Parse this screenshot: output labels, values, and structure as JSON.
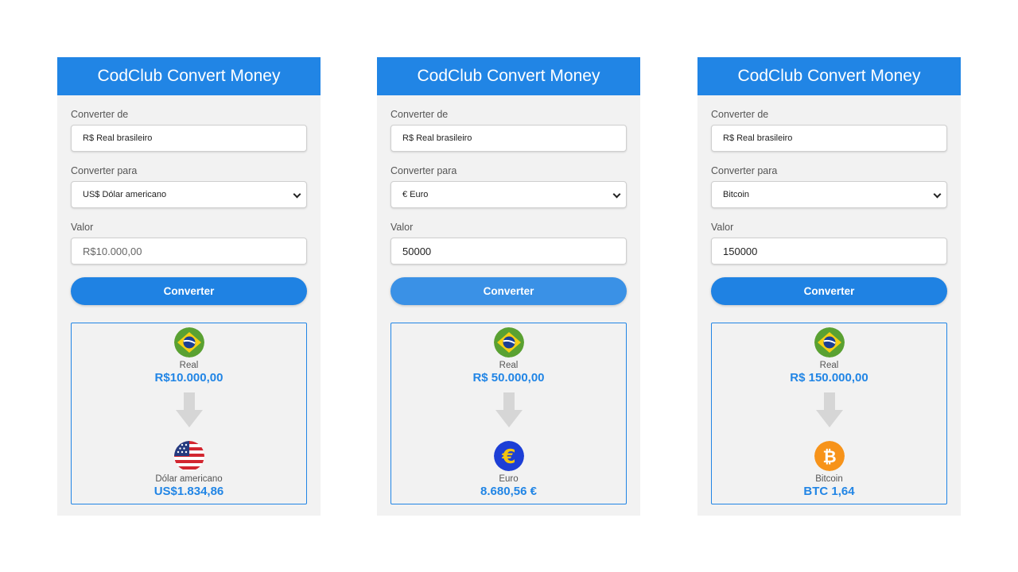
{
  "panels": [
    {
      "title": "CodClub Convert Money",
      "from_label": "Converter de",
      "from_value": "R$ Real brasileiro",
      "to_label": "Converter para",
      "to_value": "US$ Dólar americano",
      "amount_label": "Valor",
      "amount_value": "R$10.000,00",
      "amount_is_placeholder": true,
      "button_label": "Converter",
      "source_name": "Real",
      "source_amount": "R$10.000,00",
      "target_name": "Dólar americano",
      "target_amount": "US$1.834,86",
      "target_icon": "us-flag-icon"
    },
    {
      "title": "CodClub Convert Money",
      "from_label": "Converter de",
      "from_value": "R$ Real brasileiro",
      "to_label": "Converter para",
      "to_value": "€ Euro",
      "amount_label": "Valor",
      "amount_value": "50000",
      "amount_is_placeholder": false,
      "button_label": "Converter",
      "source_name": "Real",
      "source_amount": "R$ 50.000,00",
      "target_name": "Euro",
      "target_amount": "8.680,56 €",
      "target_icon": "euro-icon"
    },
    {
      "title": "CodClub Convert Money",
      "from_label": "Converter de",
      "from_value": "R$ Real brasileiro",
      "to_label": "Converter para",
      "to_value": "Bitcoin",
      "amount_label": "Valor",
      "amount_value": "150000",
      "amount_is_placeholder": false,
      "button_label": "Converter",
      "source_name": "Real",
      "source_amount": "R$ 150.000,00",
      "target_name": "Bitcoin",
      "target_amount": "BTC 1,64",
      "target_icon": "bitcoin-icon"
    }
  ],
  "colors": {
    "accent": "#2185e5",
    "panel_bg": "#f2f2f2"
  },
  "icons": {
    "euro_glyph": "€",
    "bitcoin_glyph": "₿"
  }
}
